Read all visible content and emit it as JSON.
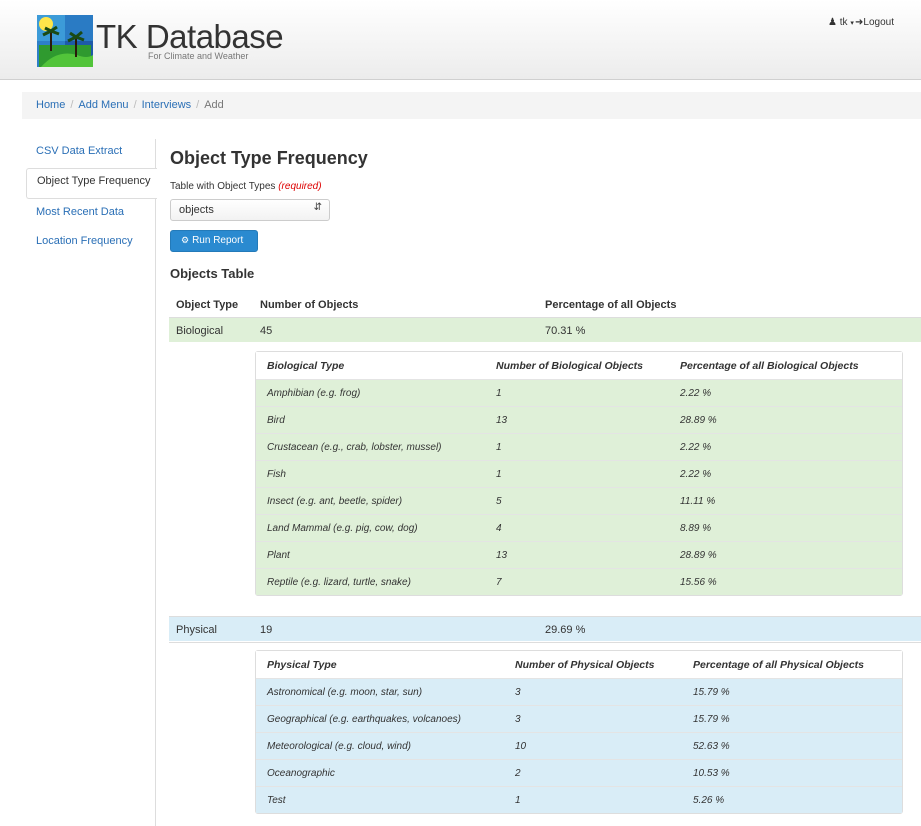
{
  "header": {
    "brand_title": "TK Database",
    "brand_subtitle": "For Climate and Weather",
    "user_label": "tk",
    "logout_label": "Logout"
  },
  "breadcrumb": [
    "Home",
    "Add Menu",
    "Interviews",
    "Add"
  ],
  "sidebar": {
    "items": [
      {
        "label": "CSV Data Extract",
        "active": false
      },
      {
        "label": "Object Type Frequency",
        "active": true
      },
      {
        "label": "Most Recent Data",
        "active": false
      },
      {
        "label": "Location Frequency",
        "active": false
      }
    ]
  },
  "main": {
    "title": "Object Type Frequency",
    "field_label": "Table with Object Types",
    "field_required": "(required)",
    "select_value": "objects",
    "run_button": "Run Report",
    "section_title": "Objects Table"
  },
  "objects_table": {
    "headers": [
      "Object Type",
      "Number of Objects",
      "Percentage of all Objects"
    ],
    "biological": {
      "type": "Biological",
      "count": "45",
      "percent": "70.31 %",
      "headers": [
        "Biological Type",
        "Number of Biological Objects",
        "Percentage of all Biological Objects"
      ],
      "rows": [
        [
          "Amphibian (e.g. frog)",
          "1",
          "2.22 %"
        ],
        [
          "Bird",
          "13",
          "28.89 %"
        ],
        [
          "Crustacean (e.g., crab, lobster, mussel)",
          "1",
          "2.22 %"
        ],
        [
          "Fish",
          "1",
          "2.22 %"
        ],
        [
          "Insect (e.g. ant, beetle, spider)",
          "5",
          "11.11 %"
        ],
        [
          "Land Mammal (e.g. pig, cow, dog)",
          "4",
          "8.89 %"
        ],
        [
          "Plant",
          "13",
          "28.89 %"
        ],
        [
          "Reptile (e.g. lizard, turtle, snake)",
          "7",
          "15.56 %"
        ]
      ]
    },
    "physical": {
      "type": "Physical",
      "count": "19",
      "percent": "29.69 %",
      "headers": [
        "Physical Type",
        "Number of Physical Objects",
        "Percentage of all Physical Objects"
      ],
      "rows": [
        [
          "Astronomical (e.g. moon, star, sun)",
          "3",
          "15.79 %"
        ],
        [
          "Geographical (e.g. earthquakes, volcanoes)",
          "3",
          "15.79 %"
        ],
        [
          "Meteorological (e.g. cloud, wind)",
          "10",
          "52.63 %"
        ],
        [
          "Oceanographic",
          "2",
          "10.53 %"
        ],
        [
          "Test",
          "1",
          "5.26 %"
        ]
      ]
    }
  },
  "colors": {
    "link": "#2a6fb6",
    "biological_row": "#dff0d8",
    "physical_row": "#d9edf7",
    "button": "#2a8ad0",
    "required": "#dd0000"
  }
}
